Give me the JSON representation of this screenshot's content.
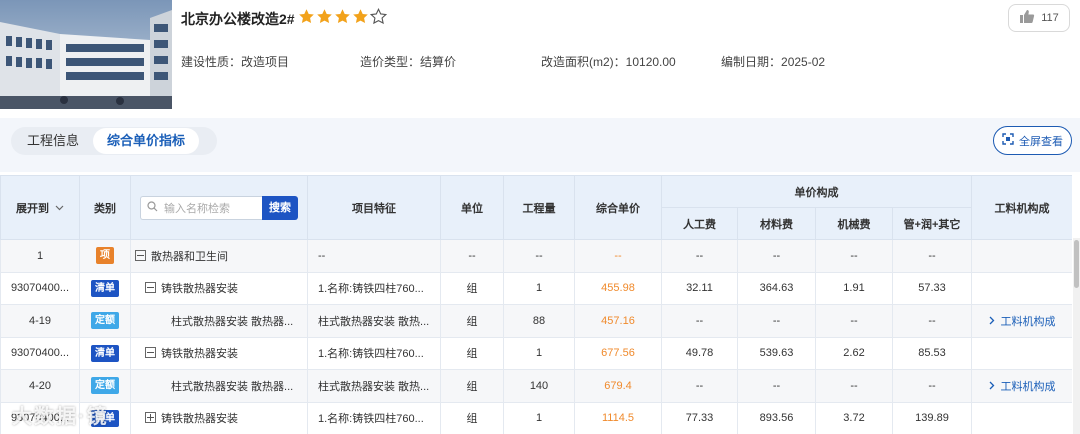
{
  "header": {
    "title": "北京办公楼改造2#",
    "rating": 4,
    "rating_max": 5,
    "likes": "117",
    "meta": [
      {
        "label": "建设性质：",
        "value": "改造项目"
      },
      {
        "label": "造价类型：",
        "value": "结算价"
      },
      {
        "label": "改造面积(m2)：",
        "value": "10120.00"
      },
      {
        "label": "编制日期：",
        "value": "2025-02"
      }
    ]
  },
  "tabs": [
    {
      "label": "工程信息",
      "active": false
    },
    {
      "label": "综合单价指标",
      "active": true
    }
  ],
  "fullscreen_label": "全屏查看",
  "table": {
    "headers": {
      "expand": "展开到",
      "category": "类别",
      "search_placeholder": "输入名称检索",
      "search_button": "搜索",
      "feature": "项目特征",
      "unit": "单位",
      "quantity": "工程量",
      "unit_price": "综合单价",
      "composition": "单价构成",
      "labor": "人工费",
      "material": "材料费",
      "machine": "机械费",
      "mgmt": "管+润+其它",
      "lmm": "工料机构成"
    },
    "rows": [
      {
        "code": "1",
        "badge": "项",
        "badge_type": "xiang",
        "toggle": "minus",
        "indent": 0,
        "name": "散热器和卫生间",
        "feature": "--",
        "unit": "--",
        "qty": "--",
        "price": "--",
        "labor": "--",
        "material": "--",
        "machine": "--",
        "mgmt": "--",
        "link": "",
        "gray": true
      },
      {
        "code": "93070400...",
        "badge": "清单",
        "badge_type": "qingdan",
        "toggle": "minus",
        "indent": 1,
        "name": "铸铁散热器安装",
        "feature": "1.名称:铸铁四柱760...",
        "unit": "组",
        "qty": "1",
        "price": "455.98",
        "labor": "32.11",
        "material": "364.63",
        "machine": "1.91",
        "mgmt": "57.33",
        "link": "",
        "gray": false
      },
      {
        "code": "4-19",
        "badge": "定额",
        "badge_type": "dinge",
        "toggle": "",
        "indent": 2,
        "name": "柱式散热器安装 散热器...",
        "feature": "柱式散热器安装 散热...",
        "unit": "组",
        "qty": "88",
        "price": "457.16",
        "labor": "--",
        "material": "--",
        "machine": "--",
        "mgmt": "--",
        "link": "工料机构成",
        "gray": true
      },
      {
        "code": "93070400...",
        "badge": "清单",
        "badge_type": "qingdan",
        "toggle": "minus",
        "indent": 1,
        "name": "铸铁散热器安装",
        "feature": "1.名称:铸铁四柱760...",
        "unit": "组",
        "qty": "1",
        "price": "677.56",
        "labor": "49.78",
        "material": "539.63",
        "machine": "2.62",
        "mgmt": "85.53",
        "link": "",
        "gray": false
      },
      {
        "code": "4-20",
        "badge": "定额",
        "badge_type": "dinge",
        "toggle": "",
        "indent": 2,
        "name": "柱式散热器安装 散热器...",
        "feature": "柱式散热器安装 散热...",
        "unit": "组",
        "qty": "140",
        "price": "679.4",
        "labor": "--",
        "material": "--",
        "machine": "--",
        "mgmt": "--",
        "link": "工料机构成",
        "gray": true
      },
      {
        "code": "93070400...",
        "badge": "清单",
        "badge_type": "qingdan",
        "toggle": "plus",
        "indent": 1,
        "name": "铸铁散热器安装",
        "feature": "1.名称:铸铁四柱760...",
        "unit": "组",
        "qty": "1",
        "price": "1114.5",
        "labor": "77.33",
        "material": "893.56",
        "machine": "3.72",
        "mgmt": "139.89",
        "link": "",
        "gray": false
      }
    ]
  },
  "watermark": "大数据·镜",
  "colors": {
    "accent": "#1d54c3",
    "price": "#f08a2c",
    "badge_xiang": "#e8822b",
    "badge_qingdan": "#1d54c3",
    "badge_dinge": "#3fa8e8",
    "star": "#f2a21b"
  }
}
